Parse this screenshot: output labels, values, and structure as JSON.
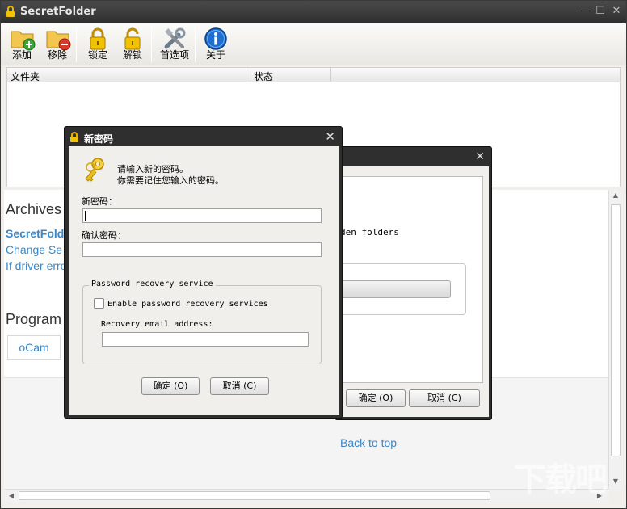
{
  "window": {
    "title": "SecretFolder"
  },
  "toolbar": {
    "buttons": [
      {
        "label": "添加",
        "icon": "folder-add-icon"
      },
      {
        "label": "移除",
        "icon": "folder-remove-icon"
      },
      {
        "label": "锁定",
        "icon": "lock-icon"
      },
      {
        "label": "解锁",
        "icon": "unlock-icon"
      },
      {
        "label": "首选项",
        "icon": "tools-icon"
      },
      {
        "label": "关于",
        "icon": "info-icon"
      }
    ]
  },
  "list": {
    "columns": [
      "文件夹",
      "状态"
    ]
  },
  "web": {
    "archives_heading": "Archives",
    "link_secretfolder": "SecretFolder",
    "link_change": "Change Se",
    "link_driver": "If driver erro",
    "program_heading": "Program",
    "ocam_label": "oCam",
    "back_to_top": "Back to top"
  },
  "back_dialog": {
    "text": "den folders",
    "ok_label": "确定 (O)",
    "cancel_label": "取消 (C)"
  },
  "dialog": {
    "title": "新密码",
    "prompt_line1": "请输入新的密码。",
    "prompt_line2": "你需要记住您输入的密码。",
    "new_password_label": "新密码：",
    "new_password_value": "",
    "confirm_password_label": "确认密码：",
    "confirm_password_value": "",
    "recovery_group": "Password recovery service",
    "enable_recovery_label": "Enable password recovery services",
    "enable_recovery_checked": false,
    "recovery_email_label": "Recovery email address:",
    "recovery_email_value": "",
    "ok_label": "确定 (O)",
    "cancel_label": "取消 (C)"
  },
  "watermark": "下载吧",
  "colors": {
    "link": "#3c86c4",
    "titlebar": "#2f2f2f"
  }
}
